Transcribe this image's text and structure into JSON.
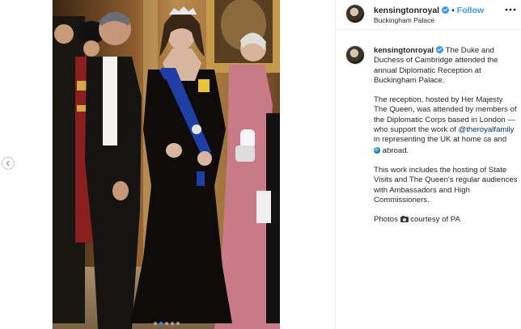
{
  "post": {
    "username": "kensingtonroyal",
    "follow_separator": "•",
    "follow_label": "Follow",
    "location": "Buckingham Palace",
    "caption": {
      "p1": "The Duke and Duchess of Cambridge attended the annual Diplomatic Reception at Buckingham Palace.",
      "p2_a": "The reception, hosted by Her Majesty The Queen, was attended by members of the Diplomatic Corps based in London — who support the work of ",
      "mention": "@theroyalfamily",
      "p2_b": " in representing the UK at home ",
      "gb_flag": "GB",
      "p2_c": " and ",
      "p2_d": " abroad.",
      "p3": "This work includes the hosting of State Visits and The Queen's regular audiences with Ambassadors and High Commissioners.",
      "p4_a": "Photos ",
      "p4_b": " courtesy of PA"
    },
    "carousel": {
      "count": 5,
      "active_index": 1
    }
  },
  "colors": {
    "accent": "#3897f0",
    "mention": "#003569",
    "border": "#efefef"
  },
  "icons": [
    "verified-badge-icon",
    "more-options-icon",
    "chevron-left-icon",
    "globe-emoji-icon",
    "camera-emoji-icon"
  ]
}
